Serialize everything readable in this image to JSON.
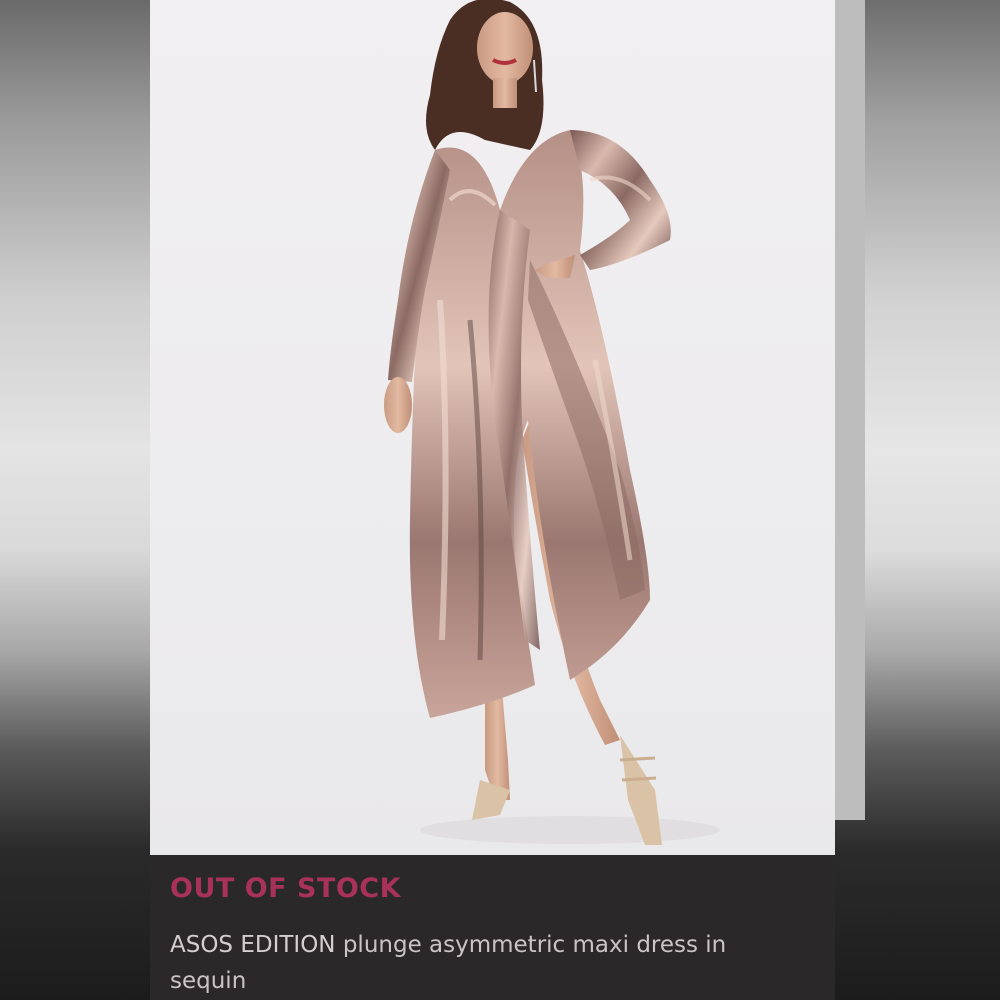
{
  "listing": {
    "stock_status": "OUT OF STOCK",
    "brand": "ASOS EDITION",
    "title": "plunge asymmetric maxi dress in sequin"
  },
  "colors": {
    "stock_status": "#a8325a",
    "footer_background": "#2b2829",
    "dress_sequin": "#c9a49a"
  },
  "image": {
    "subject": "model wearing rose-gold sequin long-sleeve maxi dress with thigh-high slit and strappy heels"
  }
}
